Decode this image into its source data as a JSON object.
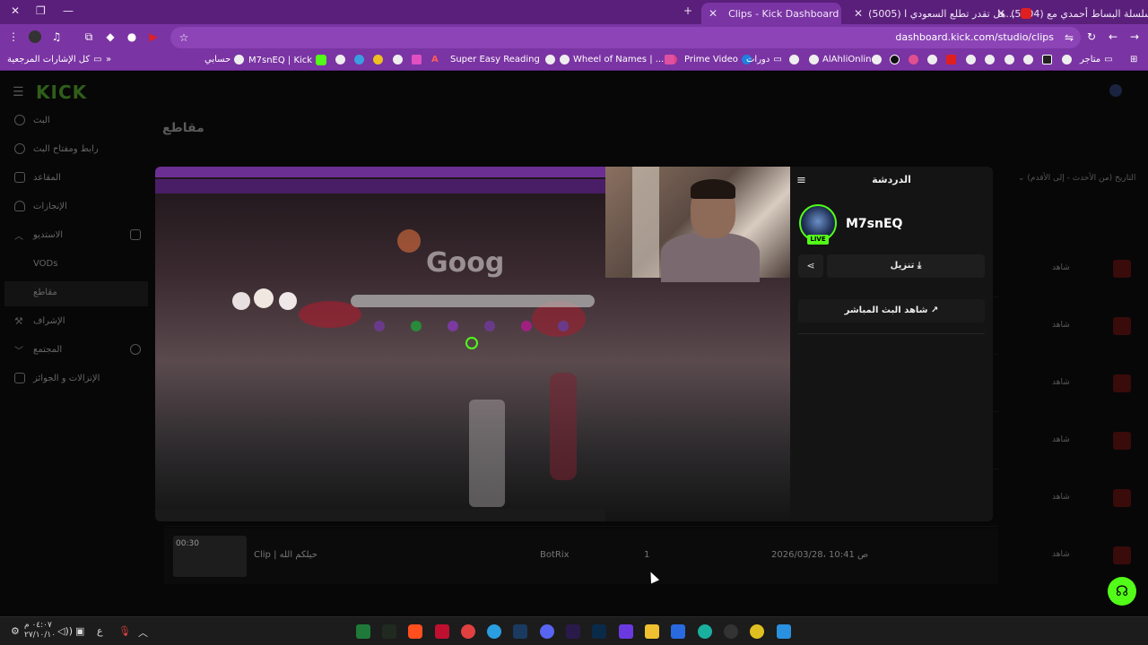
{
  "tabs": [
    {
      "title": "(5004) سلسلة البساط أحمدي مع",
      "active": false
    },
    {
      "title": "(5005) هل تقدر تطلع السعودي ا...",
      "active": false
    },
    {
      "title": "Clips - Kick Dashboard",
      "active": true
    }
  ],
  "url": "dashboard.kick.com/studio/clips",
  "bookmarks": [
    {
      "label": "كل الإشارات المرجعية"
    },
    {
      "label": "حسابي"
    },
    {
      "label": "M7snEQ | Kick"
    },
    {
      "label": "Super Easy Reading"
    },
    {
      "label": "Wheel of Names | ..."
    },
    {
      "label": "Prime Video"
    },
    {
      "label": "دورات"
    },
    {
      "label": "AlAhliOnline"
    },
    {
      "label": "متاجر"
    }
  ],
  "sidebar": {
    "logo": "KICK",
    "items": [
      {
        "label": "البث"
      },
      {
        "label": "رابط ومفتاح البث"
      },
      {
        "label": "المقاعد"
      },
      {
        "label": "الإنجازات"
      },
      {
        "label": "الاستديو"
      },
      {
        "label": "VODs"
      },
      {
        "label": "مقاطع"
      },
      {
        "label": "الإشراف"
      },
      {
        "label": "المجتمع"
      },
      {
        "label": "الإنزالات و الجوائز"
      }
    ]
  },
  "page": {
    "title": "مقاطع",
    "sort_label": "التاريخ (من الأحدث - إلى الأقدم)",
    "watch_label": "شاهد"
  },
  "modal": {
    "panel_title": "الدردشة",
    "channel": "M7snEQ",
    "live_badge": "LIVE",
    "download_label": "تنزيل",
    "watch_live_label": "شاهد البث المباشر",
    "video_google_text": "Goog"
  },
  "clip_row": {
    "duration": "00:30",
    "title": "Clip | حيلكم الله",
    "author": "BotRix",
    "views": "1",
    "date": "2026/03/28، 10:41 ص",
    "watch": "شاهد"
  },
  "taskbar": {
    "clock_time": "٠٤:٠٧ م",
    "clock_date": "٢٧/١٠/١٠",
    "lang": "ع"
  },
  "colors": {
    "kick_green": "#53fc18",
    "chrome_purple": "#7a34a3"
  }
}
